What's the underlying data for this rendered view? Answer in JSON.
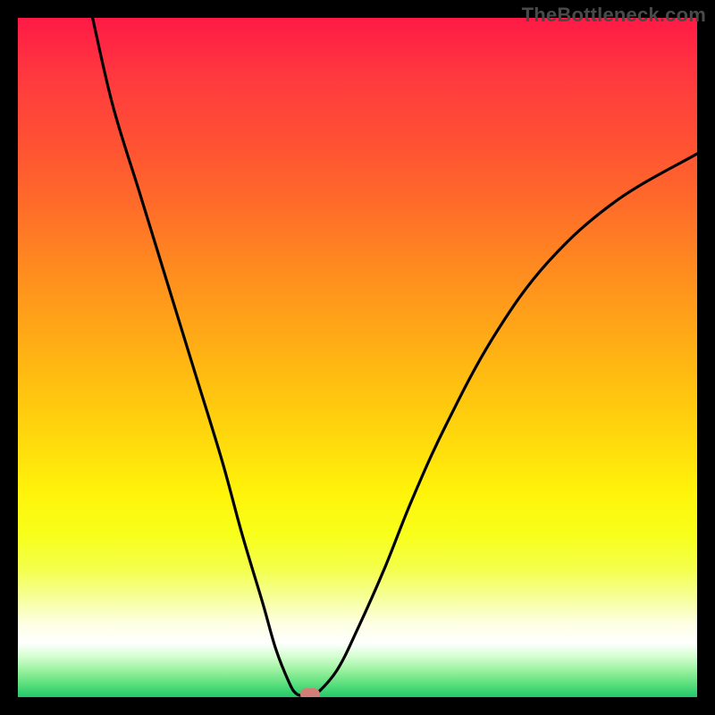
{
  "watermark": "TheBottleneck.com",
  "colors": {
    "frame_border": "#000000",
    "curve_stroke": "#000000",
    "marker_fill": "#d37d78",
    "watermark_text": "#4a4a4a",
    "gradient_top": "#ff1a46",
    "gradient_mid": "#fff40a",
    "gradient_bottom": "#22c96a"
  },
  "chart_data": {
    "type": "line",
    "title": "",
    "xlabel": "",
    "ylabel": "",
    "xlim": [
      0,
      100
    ],
    "ylim": [
      0,
      100
    ],
    "series": [
      {
        "name": "bottleneck-curve",
        "x": [
          11,
          14,
          18,
          22,
          26,
          30,
          33,
          36,
          38,
          40,
          41,
          42,
          43,
          44,
          47,
          50,
          54,
          58,
          63,
          70,
          78,
          88,
          100
        ],
        "y": [
          100,
          87,
          74,
          61,
          48,
          35,
          24,
          14,
          7,
          2,
          0.5,
          0.2,
          0.2,
          0.5,
          4,
          10,
          19,
          29,
          40,
          53,
          64,
          73,
          80
        ]
      }
    ],
    "marker": {
      "x": 43,
      "y": 0.4
    },
    "grid": false,
    "legend": false
  }
}
